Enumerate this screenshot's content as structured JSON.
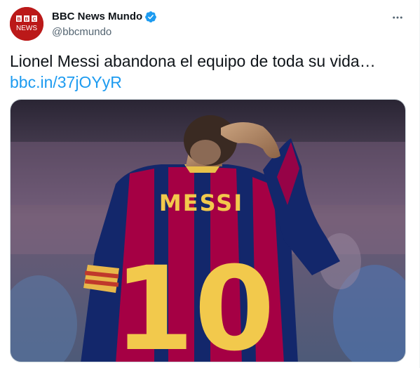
{
  "account": {
    "display_name": "BBC News Mundo",
    "handle": "@bbcmundo",
    "avatar_text_top": "BBC",
    "avatar_text_bottom": "NEWS",
    "verified": true
  },
  "tweet": {
    "text": "Lionel Messi abandona el equipo de toda su vida…",
    "link": "bbc.in/37jOYyR"
  },
  "media": {
    "jersey_name": "MESSI",
    "jersey_number": "10"
  },
  "colors": {
    "link": "#1d9bf0",
    "verified": "#1d9bf0",
    "bbc_red": "#bb1919"
  },
  "icons": [
    "verified-badge-icon",
    "more-options-icon"
  ]
}
